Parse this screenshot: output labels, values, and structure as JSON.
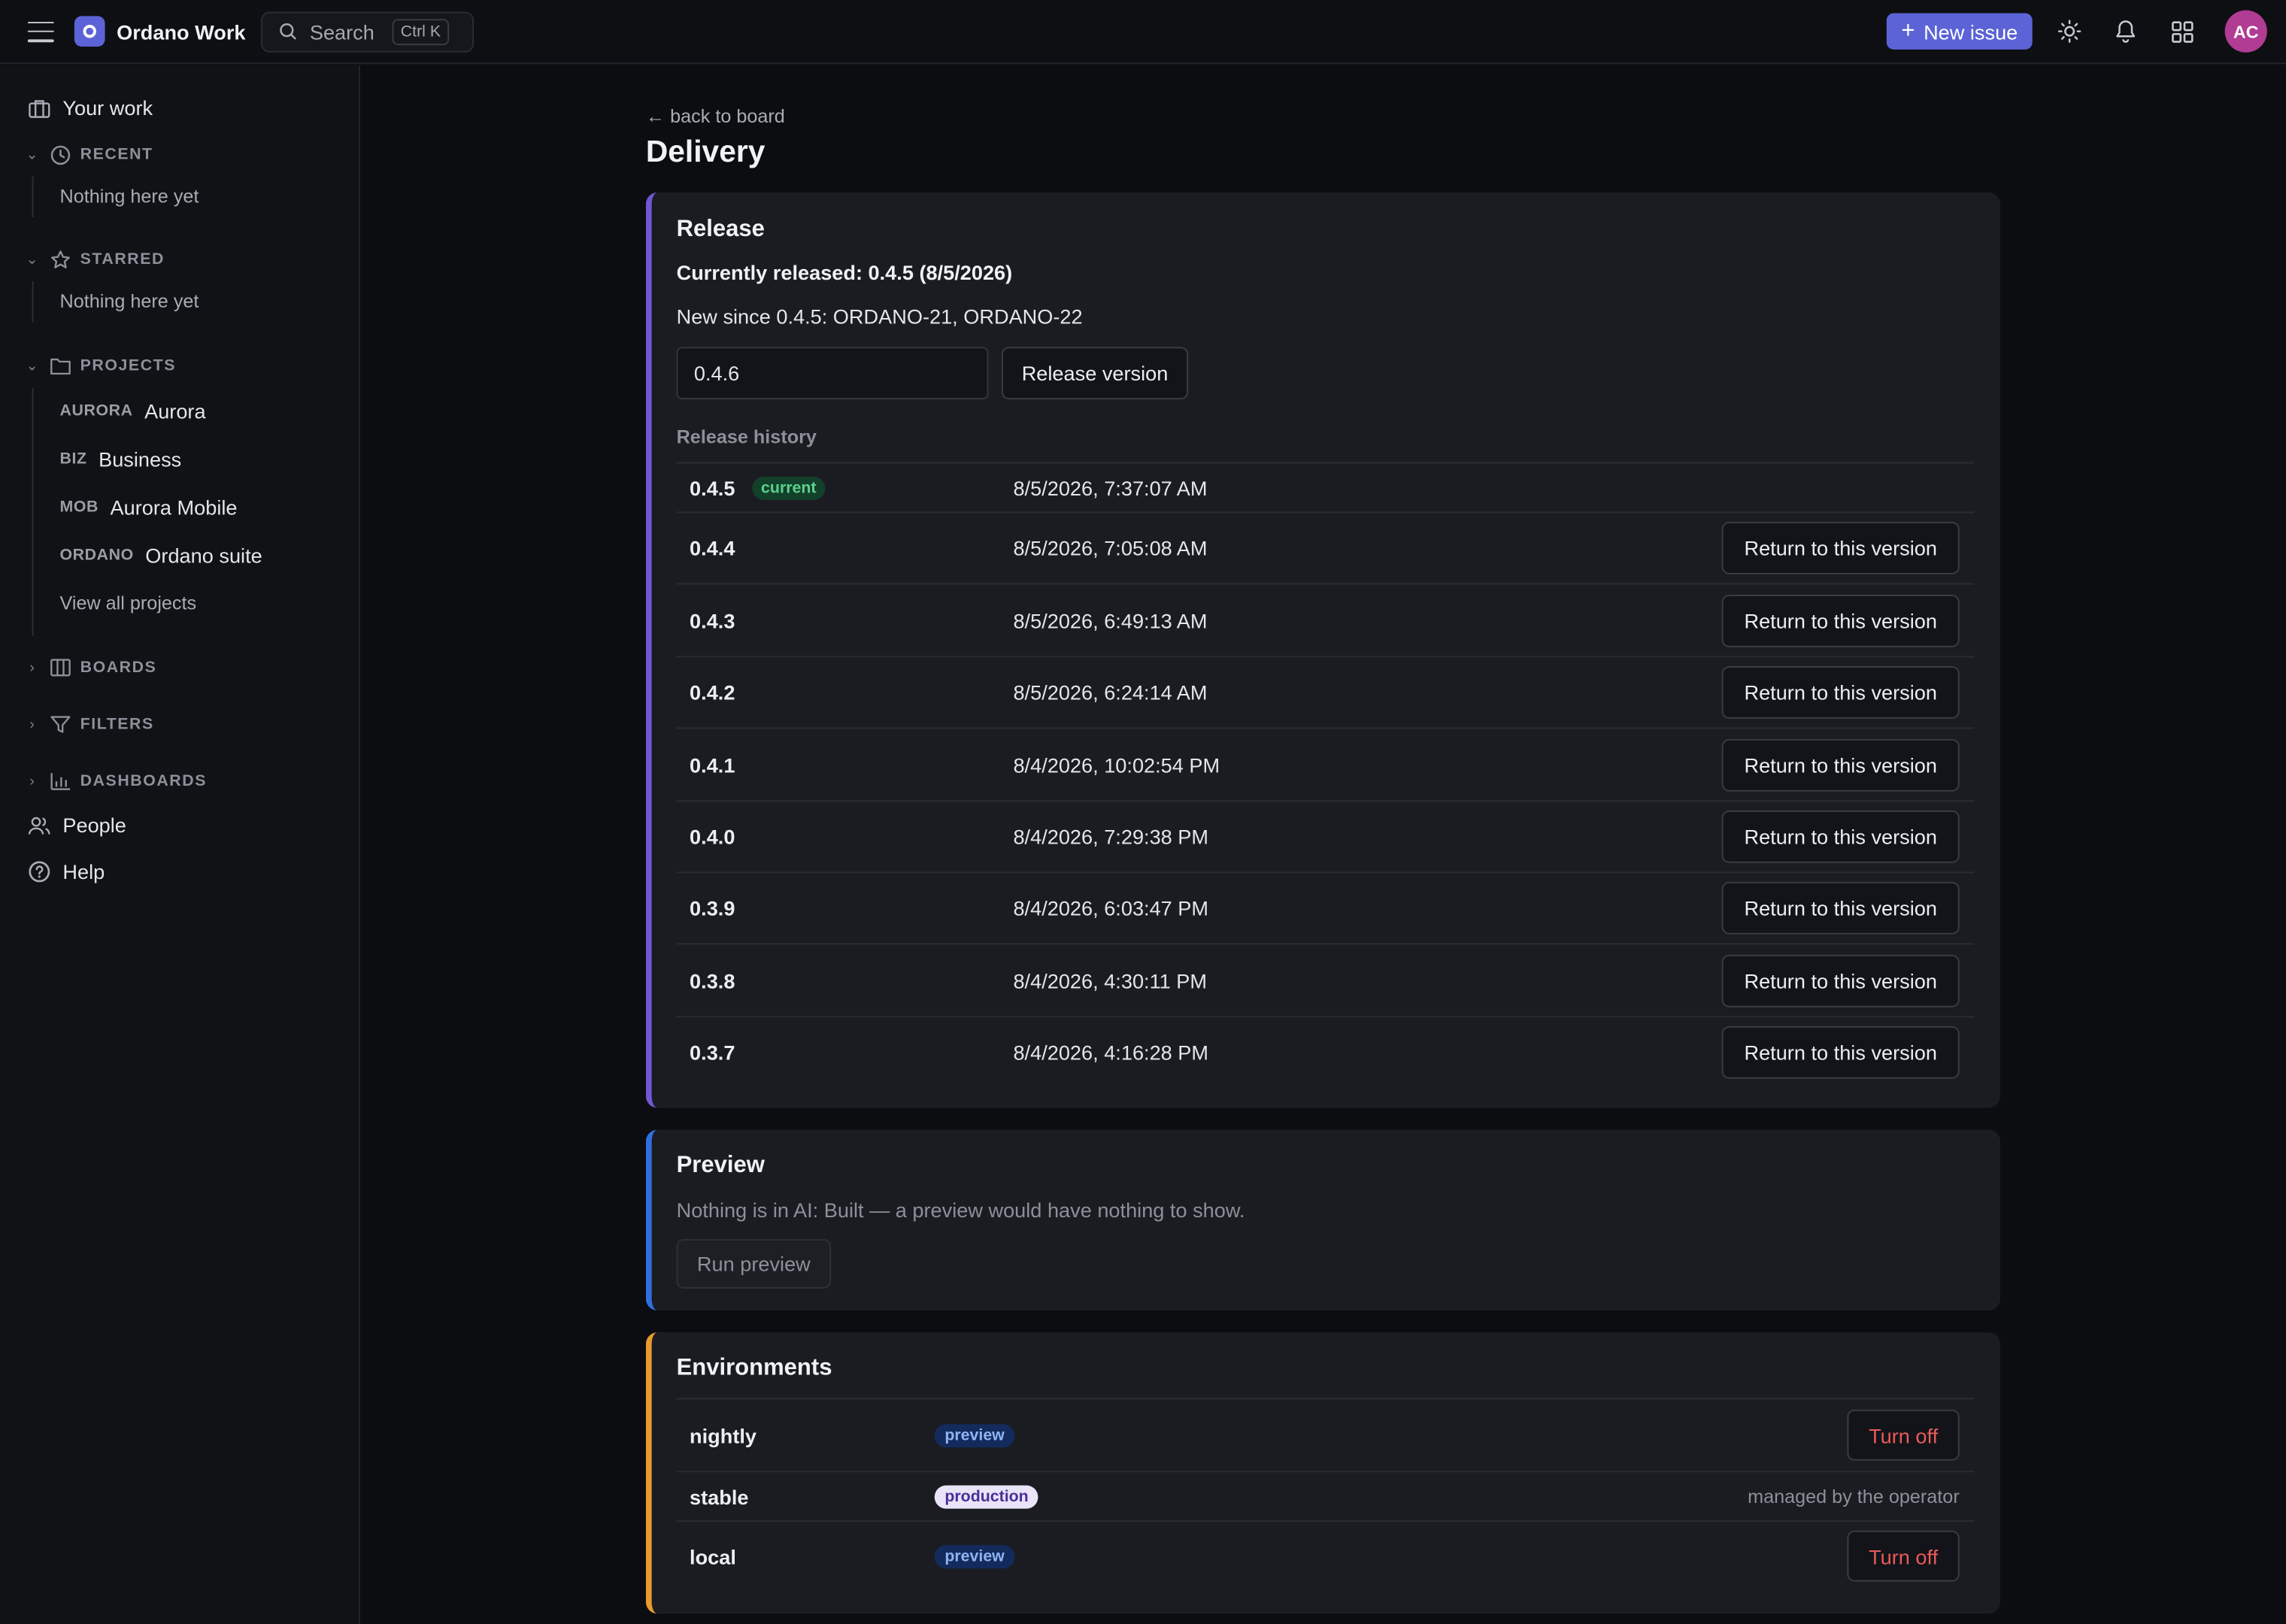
{
  "app": {
    "title": "Ordano Work"
  },
  "topbar": {
    "search_label": "Search",
    "search_shortcut": "Ctrl K",
    "new_issue_label": "New issue",
    "avatar_initials": "AC",
    "accent_color": "#5b63d6"
  },
  "sidebar": {
    "your_work": "Your work",
    "recent": {
      "label": "RECENT",
      "empty": "Nothing here yet"
    },
    "starred": {
      "label": "STARRED",
      "empty": "Nothing here yet"
    },
    "projects": {
      "label": "PROJECTS",
      "items": [
        {
          "key": "AURORA",
          "name": "Aurora"
        },
        {
          "key": "BIZ",
          "name": "Business"
        },
        {
          "key": "MOB",
          "name": "Aurora Mobile"
        },
        {
          "key": "ORDANO",
          "name": "Ordano suite"
        }
      ],
      "view_all": "View all projects"
    },
    "boards": "BOARDS",
    "filters": "FILTERS",
    "dashboards": "DASHBOARDS",
    "people": "People",
    "help": "Help"
  },
  "page": {
    "back_link": "← back to board",
    "title": "Delivery"
  },
  "release": {
    "title": "Release",
    "currently_released": "Currently released: 0.4.5 (8/5/2026)",
    "new_since": "New since 0.4.5: ORDANO-21, ORDANO-22",
    "version_input_value": "0.4.6",
    "release_button": "Release version",
    "history_label": "Release history",
    "current_badge": "current",
    "return_label": "Return to this version",
    "history": [
      {
        "version": "0.4.5",
        "date": "8/5/2026, 7:37:07 AM",
        "current": true
      },
      {
        "version": "0.4.4",
        "date": "8/5/2026, 7:05:08 AM"
      },
      {
        "version": "0.4.3",
        "date": "8/5/2026, 6:49:13 AM"
      },
      {
        "version": "0.4.2",
        "date": "8/5/2026, 6:24:14 AM"
      },
      {
        "version": "0.4.1",
        "date": "8/4/2026, 10:02:54 PM"
      },
      {
        "version": "0.4.0",
        "date": "8/4/2026, 7:29:38 PM"
      },
      {
        "version": "0.3.9",
        "date": "8/4/2026, 6:03:47 PM"
      },
      {
        "version": "0.3.8",
        "date": "8/4/2026, 4:30:11 PM"
      },
      {
        "version": "0.3.7",
        "date": "8/4/2026, 4:16:28 PM"
      }
    ]
  },
  "preview": {
    "title": "Preview",
    "message": "Nothing is in AI: Built — a preview would have nothing to show.",
    "run_button": "Run preview"
  },
  "environments": {
    "title": "Environments",
    "items": [
      {
        "name": "nightly",
        "badge": "preview",
        "action": "Turn off"
      },
      {
        "name": "stable",
        "badge": "production",
        "note": "managed by the operator"
      },
      {
        "name": "local",
        "badge": "preview",
        "action": "Turn off"
      }
    ]
  }
}
